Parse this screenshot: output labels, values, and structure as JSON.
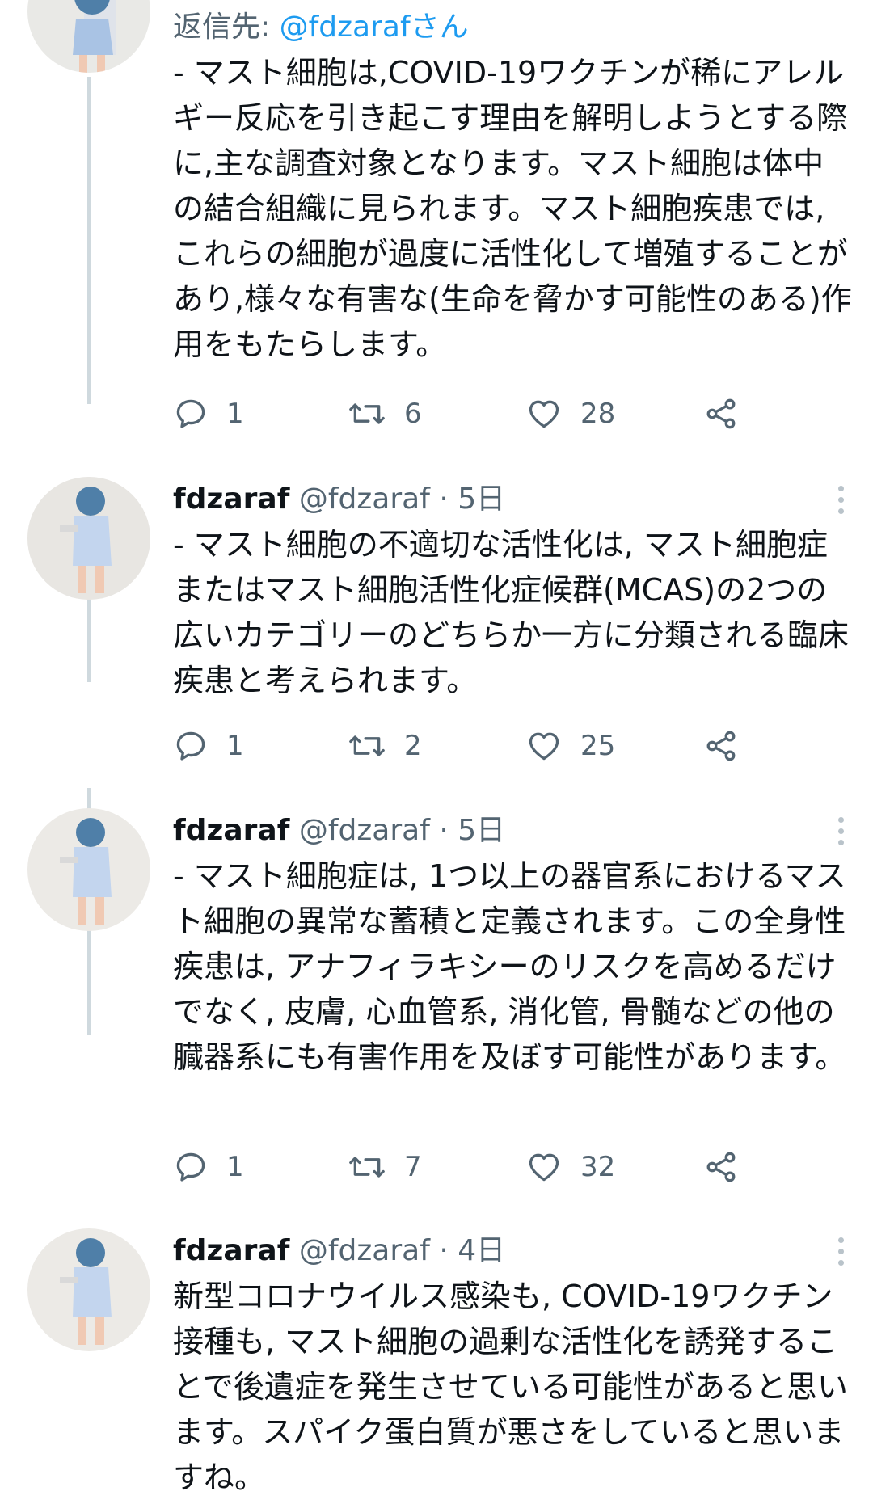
{
  "tweets": [
    {
      "reply_label": "返信先:",
      "reply_to": "@fdzarafさん",
      "text": "- マスト細胞は,COVID-19ワクチンが稀にアレルギー反応を引き起こす理由を解明しようとする際に,主な調査対象となります。マスト細胞は体中の結合組織に見られます。マスト細胞疾患では,これらの細胞が過度に活性化して増殖することがあり,様々な有害な(生命を脅かす可能性のある)作用をもたらします。",
      "replies": "1",
      "retweets": "6",
      "likes": "28"
    },
    {
      "name": "fdzaraf",
      "handle": "@fdzaraf",
      "dot": "·",
      "time": "5日",
      "text": "- マスト細胞の不適切な活性化は, マスト細胞症またはマスト細胞活性化症候群(MCAS)の2つの広いカテゴリーのどちらか一方に分類される臨床疾患と考えられます。",
      "replies": "1",
      "retweets": "2",
      "likes": "25"
    },
    {
      "name": "fdzaraf",
      "handle": "@fdzaraf",
      "dot": "·",
      "time": "5日",
      "text": "- マスト細胞症は, 1つ以上の器官系におけるマスト細胞の異常な蓄積と定義されます。この全身性疾患は, アナフィラキシーのリスクを高めるだけでなく, 皮膚, 心血管系, 消化管, 骨髄などの他の臓器系にも有害作用を及ぼす可能性があります。",
      "replies": "1",
      "retweets": "7",
      "likes": "32"
    },
    {
      "name": "fdzaraf",
      "handle": "@fdzaraf",
      "dot": "·",
      "time": "4日",
      "text": "新型コロナウイルス感染も, COVID-19ワクチン接種も, マスト細胞の過剰な活性化を誘発することで後遺症を発生させている可能性があると思います。スパイク蛋白質が悪さをしていると思いますね。"
    }
  ],
  "icons": {
    "reply": "reply-icon",
    "retweet": "retweet-icon",
    "like": "heart-icon",
    "share": "share-icon",
    "more": "more-vertical-icon"
  },
  "colors": {
    "text": "#0f1419",
    "secondary": "#536471",
    "link": "#1d9bf0",
    "thread_line": "#cfd9de"
  }
}
